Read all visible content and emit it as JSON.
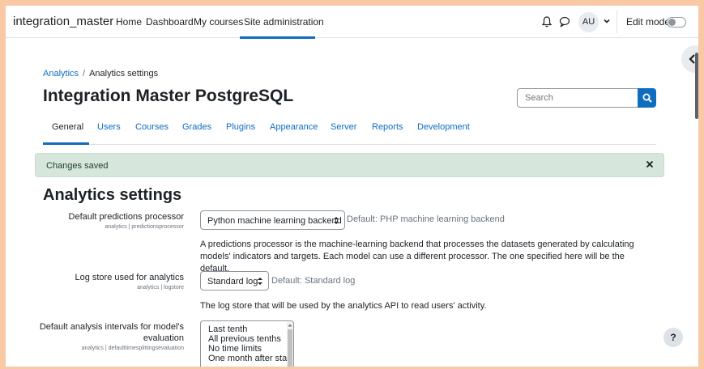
{
  "navbar": {
    "brand": "integration_master",
    "items": [
      "Home",
      "Dashboard",
      "My courses",
      "Site administration"
    ],
    "avatar_initials": "AU",
    "edit_mode_label": "Edit mode"
  },
  "breadcrumb": [
    "Analytics",
    "Analytics settings"
  ],
  "page_title": "Integration Master PostgreSQL",
  "search": {
    "placeholder": "Search"
  },
  "tabs": [
    "General",
    "Users",
    "Courses",
    "Grades",
    "Plugins",
    "Appearance",
    "Server",
    "Reports",
    "Development"
  ],
  "alert": {
    "message": "Changes saved"
  },
  "section_title": "Analytics settings",
  "settings": [
    {
      "label": "Default predictions processor",
      "sub": "analytics | predictionsprocessor",
      "value": "Python machine learning backend",
      "default": "Default: PHP machine learning backend",
      "description": "A predictions processor is the machine-learning backend that processes the datasets generated by calculating models' indicators and targets. Each model can use a different processor. The one specified here will be the default."
    },
    {
      "label": "Log store used for analytics",
      "sub": "analytics | logstore",
      "value": "Standard log",
      "default": "Default: Standard log",
      "description": "The log store that will be used by the analytics API to read users' activity."
    },
    {
      "label_line1": "Default analysis intervals for model's",
      "label_line2": "evaluation",
      "sub": "analytics | defaulttimesplittingsevaluation",
      "options": [
        "Last tenth",
        "All previous tenths",
        "No time limits",
        "One month after start"
      ]
    }
  ],
  "help_label": "?",
  "colors": {
    "accent": "#0f6cbf",
    "alert_bg": "#d7e6dc"
  }
}
